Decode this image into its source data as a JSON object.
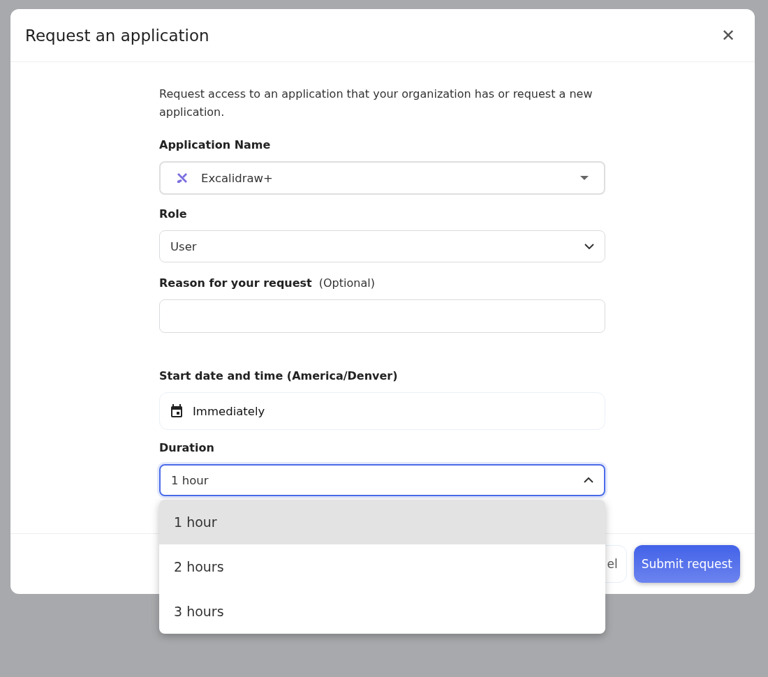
{
  "dialog": {
    "title": "Request an application",
    "close_label": "✕"
  },
  "intro": "Request access to an application that your organization has or request a new application.",
  "application": {
    "label": "Application Name",
    "value": "Excalidraw+"
  },
  "role": {
    "label": "Role",
    "value": "User"
  },
  "reason": {
    "label": "Reason for your request",
    "hint": "(Optional)"
  },
  "start": {
    "label": "Start date and time (America/Denver)",
    "value": "Immediately"
  },
  "duration": {
    "label": "Duration",
    "value": "1 hour",
    "expanded": true,
    "options": [
      {
        "label": "1 hour",
        "selected": true
      },
      {
        "label": "2 hours",
        "selected": false
      },
      {
        "label": "3 hours",
        "selected": false
      }
    ]
  },
  "buttons": {
    "cancel": "el",
    "submit": "Submit request"
  }
}
